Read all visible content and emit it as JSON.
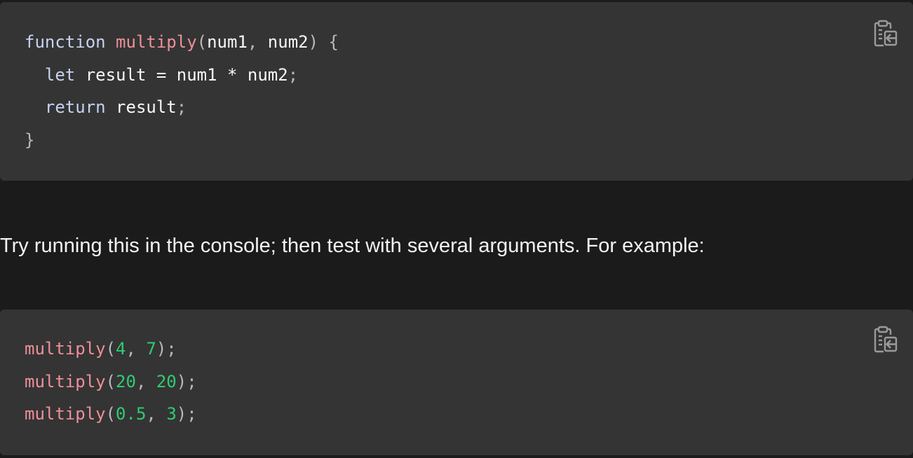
{
  "code_blocks": [
    {
      "copy_icon": "clipboard-copy-icon",
      "lines": [
        [
          {
            "t": "function",
            "k": "keyword"
          },
          {
            "t": " ",
            "k": "ident"
          },
          {
            "t": "multiply",
            "k": "func"
          },
          {
            "t": "(",
            "k": "punct"
          },
          {
            "t": "num1",
            "k": "ident"
          },
          {
            "t": ", ",
            "k": "punct"
          },
          {
            "t": "num2",
            "k": "ident"
          },
          {
            "t": ") {",
            "k": "punct"
          }
        ],
        [
          {
            "t": "  ",
            "k": "ident"
          },
          {
            "t": "let",
            "k": "keyword"
          },
          {
            "t": " result = num1 * num2",
            "k": "ident"
          },
          {
            "t": ";",
            "k": "punct"
          }
        ],
        [
          {
            "t": "  ",
            "k": "ident"
          },
          {
            "t": "return",
            "k": "keyword"
          },
          {
            "t": " result",
            "k": "ident"
          },
          {
            "t": ";",
            "k": "punct"
          }
        ],
        [
          {
            "t": "}",
            "k": "punct"
          }
        ]
      ]
    },
    {
      "copy_icon": "clipboard-copy-icon",
      "lines": [
        [
          {
            "t": "multiply",
            "k": "func"
          },
          {
            "t": "(",
            "k": "punct"
          },
          {
            "t": "4",
            "k": "num"
          },
          {
            "t": ", ",
            "k": "punct"
          },
          {
            "t": "7",
            "k": "num"
          },
          {
            "t": ");",
            "k": "punct"
          }
        ],
        [
          {
            "t": "multiply",
            "k": "func"
          },
          {
            "t": "(",
            "k": "punct"
          },
          {
            "t": "20",
            "k": "num"
          },
          {
            "t": ", ",
            "k": "punct"
          },
          {
            "t": "20",
            "k": "num"
          },
          {
            "t": ");",
            "k": "punct"
          }
        ],
        [
          {
            "t": "multiply",
            "k": "func"
          },
          {
            "t": "(",
            "k": "punct"
          },
          {
            "t": "0.5",
            "k": "num"
          },
          {
            "t": ", ",
            "k": "punct"
          },
          {
            "t": "3",
            "k": "num"
          },
          {
            "t": ");",
            "k": "punct"
          }
        ]
      ]
    }
  ],
  "prose": {
    "text": "Try running this in the console; then test with several arguments. For example:"
  },
  "colors": {
    "page_background": "#1b1b1b",
    "code_background": "#343434",
    "keyword": "#c5d3f0",
    "function_name": "#ef8f9a",
    "number": "#2ecc71",
    "punctuation": "#b9b9b9",
    "identifier": "#f7f7f7",
    "icon": "#9a9a9a"
  }
}
